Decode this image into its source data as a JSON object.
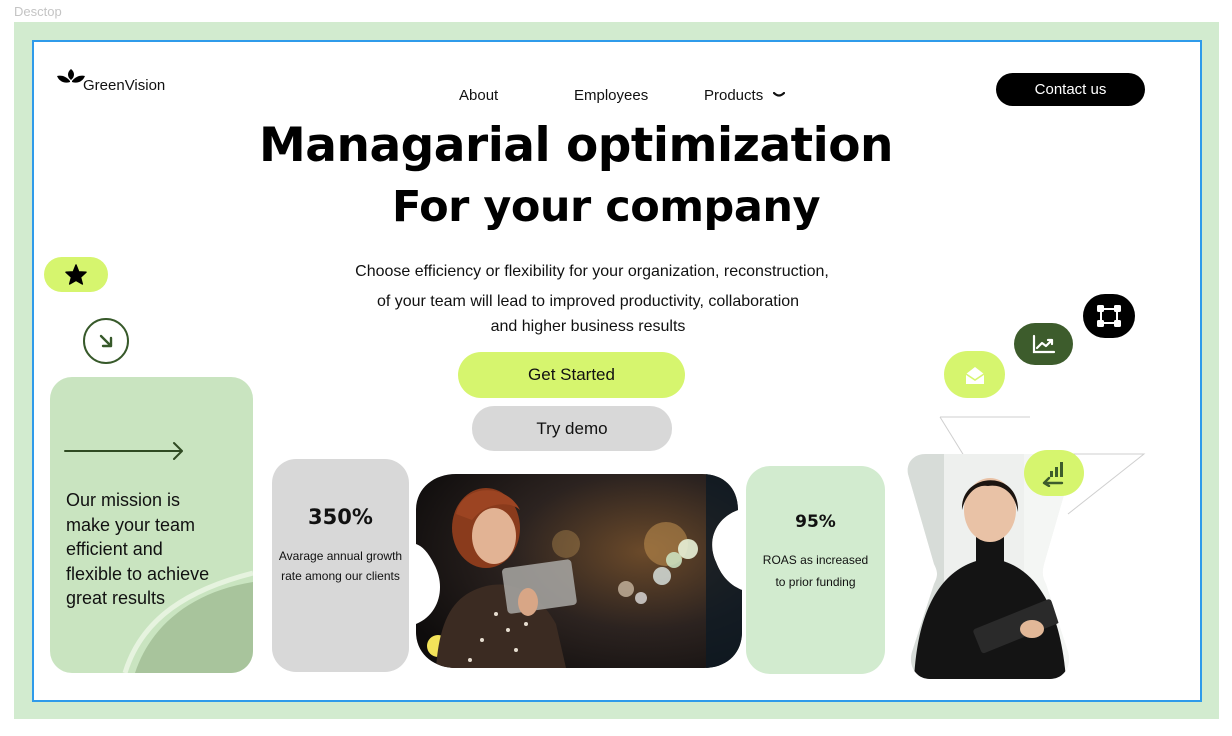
{
  "canvas_label": "Desctop",
  "brand": {
    "name": "GreenVision"
  },
  "nav": {
    "about": "About",
    "employees": "Employees",
    "products": "Products"
  },
  "contact_label": "Contact us",
  "hero": {
    "title_line1": "Managarial optimization",
    "title_line2": "For your company",
    "subtitle_line1": "Choose efficiency or flexibility for your organization, reconstruction,",
    "subtitle_line2": "of your team will lead to improved productivity, collaboration",
    "subtitle_line3": "and higher business results",
    "cta_primary": "Get Started",
    "cta_secondary": "Try demo"
  },
  "mission": {
    "line1": "Our mission is",
    "line2": "make your team",
    "line3": "efficient and",
    "line4": "flexible to achieve",
    "line5": "great results"
  },
  "stats": [
    {
      "value": "350%",
      "desc_line1": "Avarage annual growth",
      "desc_line2": "rate among our clients"
    },
    {
      "value": "95%",
      "desc_line1": "ROAS as increased",
      "desc_line2": "to prior funding"
    }
  ],
  "icons": {
    "star": "star-icon",
    "arrow_down_right": "arrow-down-right-icon",
    "arrow_right": "arrow-right-icon",
    "mail": "mail-icon",
    "chart": "trend-chart-icon",
    "frame": "frame-select-icon",
    "bars": "bars-growth-icon",
    "logo": "lotus-logo-icon"
  },
  "colors": {
    "lime": "#d6f56e",
    "pale_green": "#c9e4c0",
    "mint": "#d2ebcf",
    "dark_green": "#3d5c2c",
    "grey": "#d8d8d8",
    "black": "#000000",
    "frame_blue": "#2f9bea"
  }
}
